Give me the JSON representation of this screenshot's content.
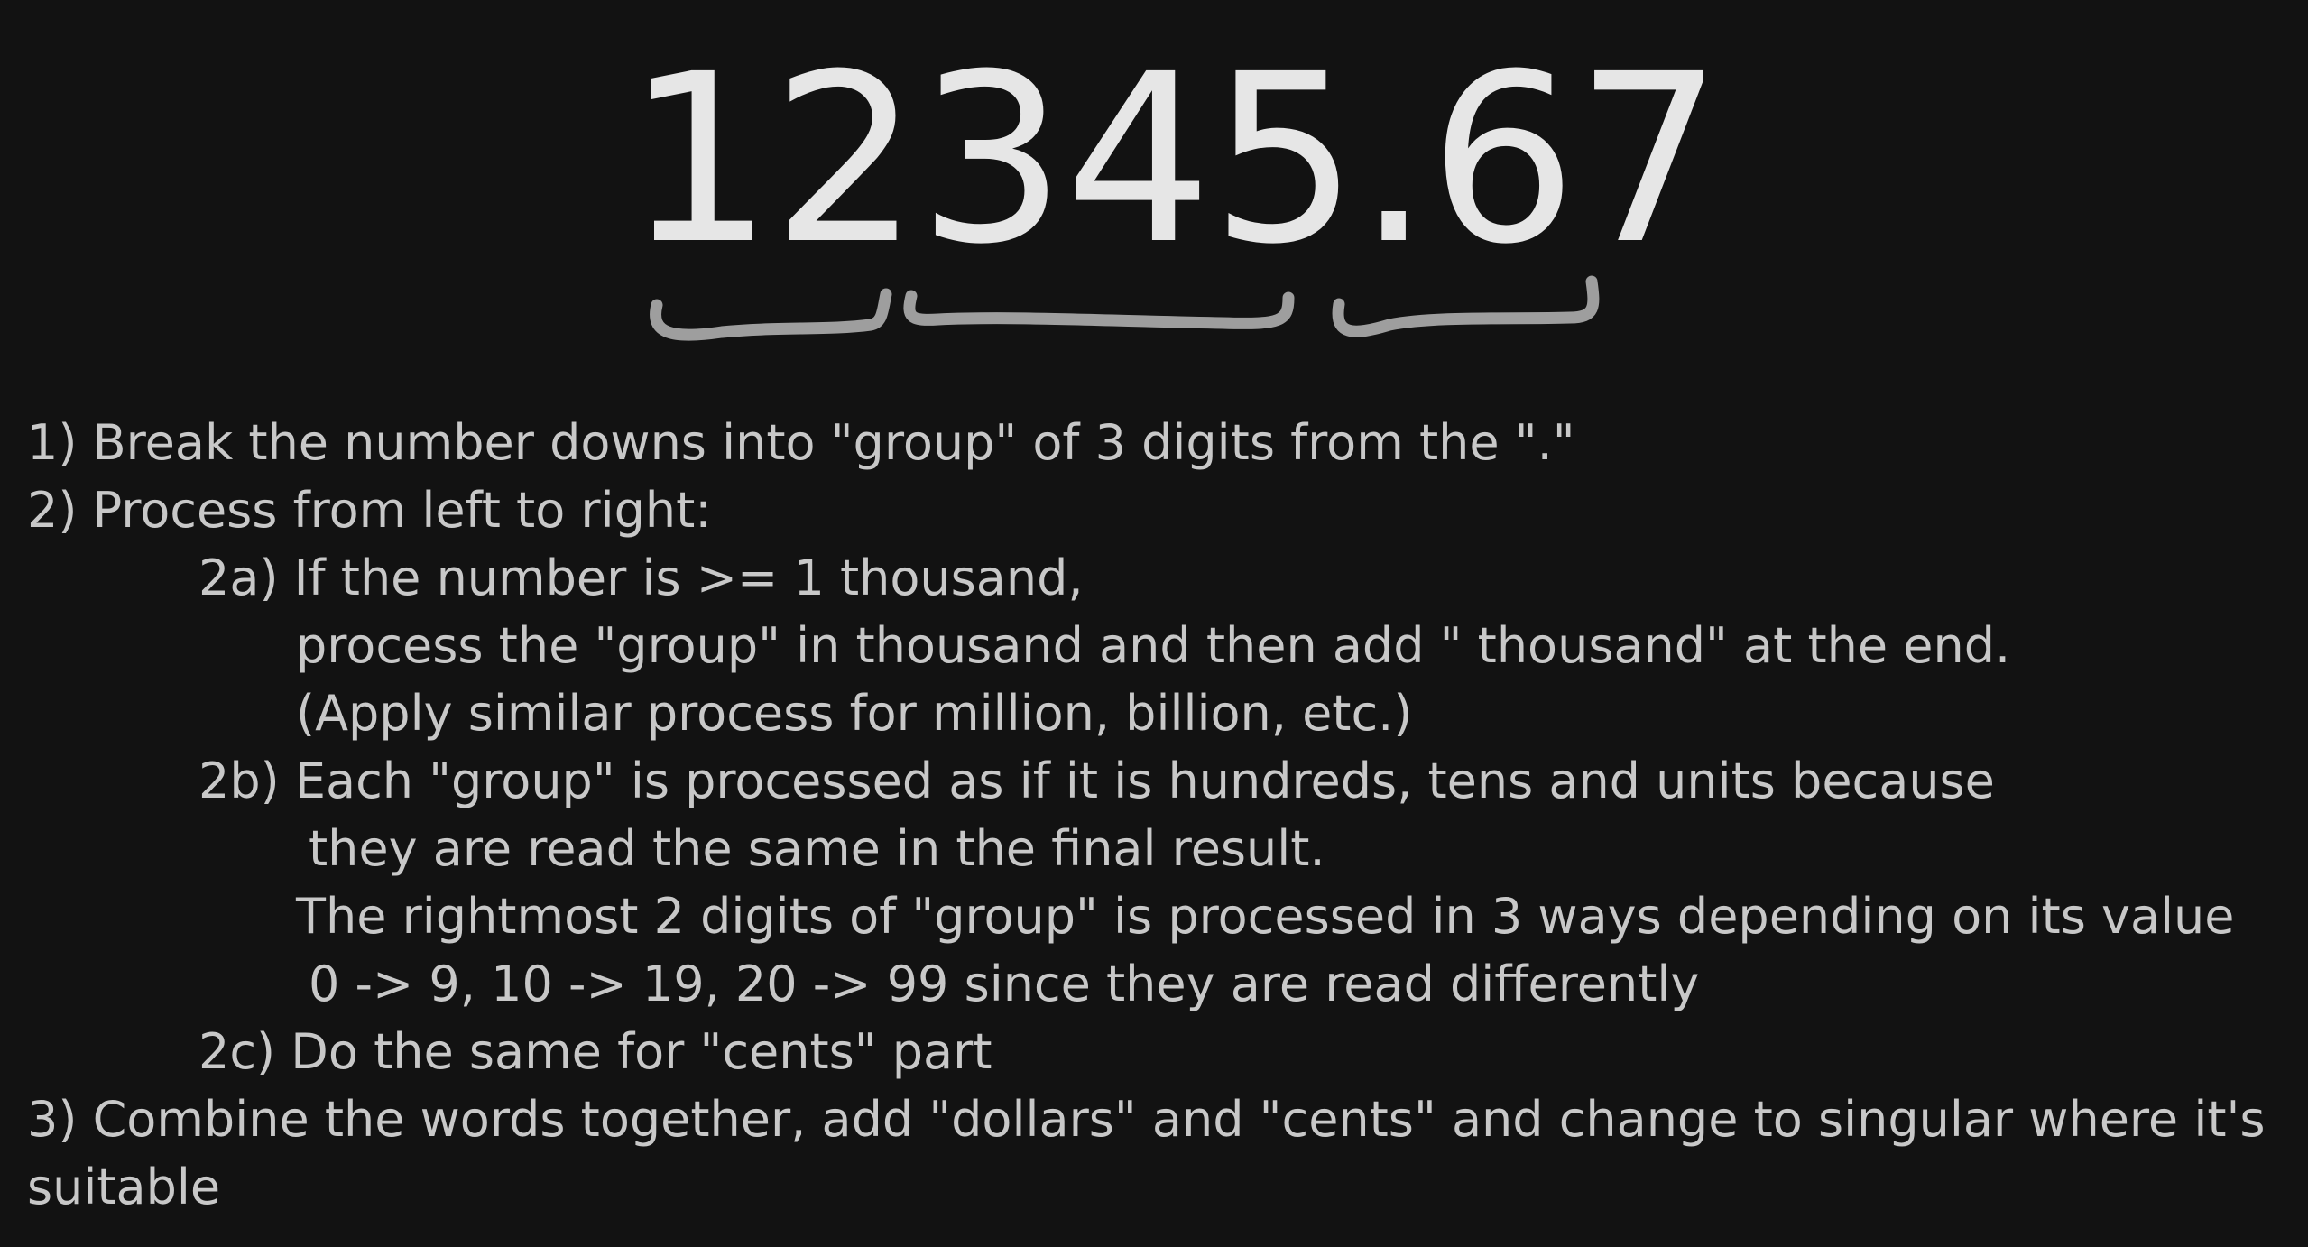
{
  "number_display": "12345.67",
  "steps": [
    "1) Break the number downs into \"group\" of 3 digits from the \".\"",
    "2) Process from left to right:",
    "2a) If the number is >= 1 thousand,",
    "process the \"group\" in thousand and then add \" thousand\" at the end.",
    "(Apply similar process for million, billion, etc.)",
    "2b) Each \"group\" is processed as if it is hundreds, tens and units because",
    "they are read the same in the final result.",
    "The rightmost 2 digits of \"group\" is processed in 3 ways depending on its value",
    "0 -> 9, 10 -> 19, 20 -> 99 since they are read differently",
    "2c) Do the same for \"cents\" part",
    "3) Combine the words together, add \"dollars\" and \"cents\" and change to singular where it's",
    "suitable"
  ],
  "colors": {
    "background": "#121212",
    "number": "#e6e6e6",
    "text": "#c8c8c8",
    "brace": "#9e9e9e"
  }
}
